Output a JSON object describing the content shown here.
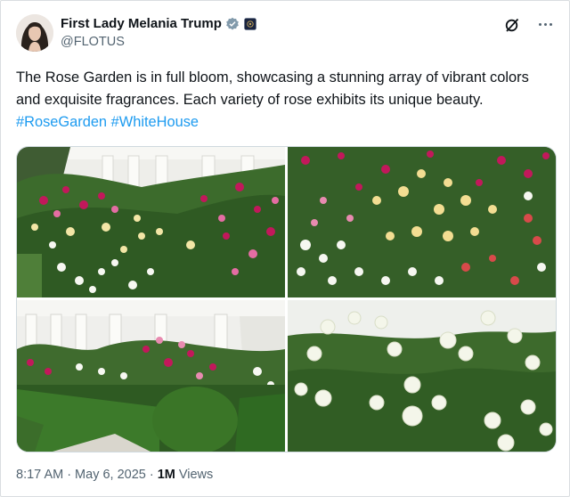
{
  "post": {
    "author_name": "First Lady Melania Trump",
    "handle": "@FLOTUS",
    "text": "The Rose Garden is in full bloom, showcasing a stunning array of vibrant colors and exquisite fragrances. Each variety of rose exhibits its unique beauty.",
    "hashtags": [
      "#RoseGarden",
      "#WhiteHouse"
    ],
    "time": "8:17 AM",
    "date": "May 6, 2025",
    "views_count": "1M",
    "views_label": "Views",
    "separator": "·"
  },
  "colors": {
    "link": "#1d9bf0",
    "verified": "#829aab",
    "muted": "#536471"
  },
  "icons": [
    "verified-badge-icon",
    "government-badge-icon",
    "grok-icon",
    "more-options-icon"
  ]
}
